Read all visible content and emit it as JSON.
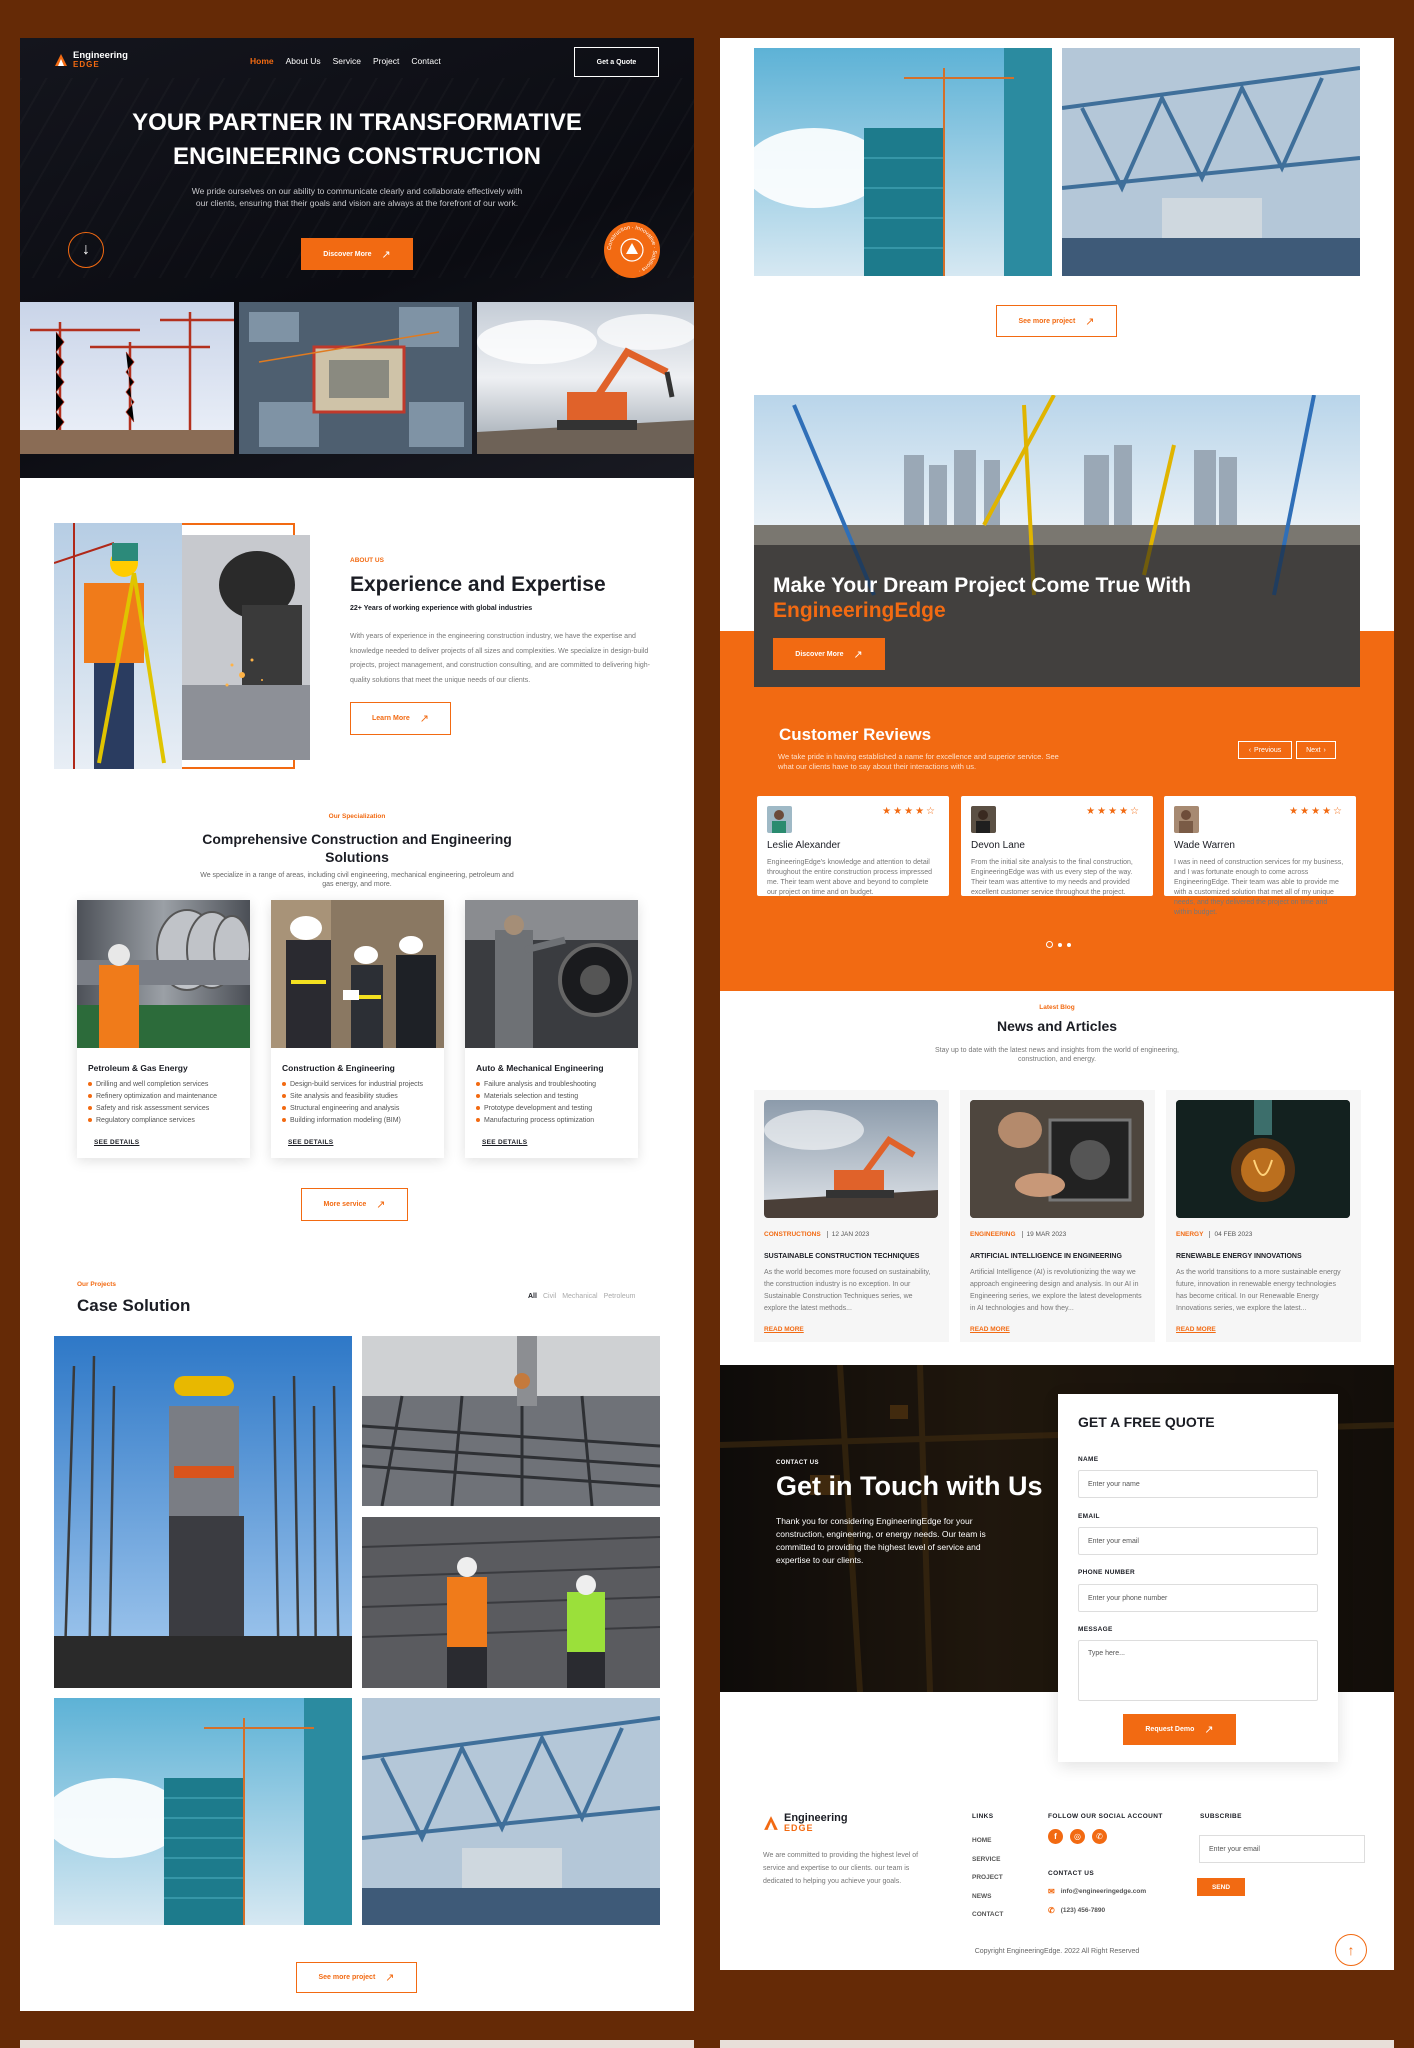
{
  "brand": {
    "name": "Engineering",
    "sub": "EDGE"
  },
  "nav": {
    "items": [
      "Home",
      "About Us",
      "Service",
      "Project",
      "Contact"
    ],
    "quote": "Get a Quote"
  },
  "hero": {
    "title1": "YOUR PARTNER IN TRANSFORMATIVE",
    "title2": "ENGINEERING CONSTRUCTION",
    "text": "We pride ourselves on our ability to communicate clearly and collaborate effectively with our clients, ensuring that their goals and vision are always at the forefront of our work.",
    "cta": "Discover More"
  },
  "about": {
    "tag": "ABOUT US",
    "title": "Experience and Expertise",
    "sub": "22+ Years of working experience with global industries",
    "text": "With years of experience in the engineering construction industry, we have the expertise and knowledge needed to deliver projects of all sizes and complexities. We specialize in design-build projects, project management, and construction consulting, and are committed to delivering high-quality solutions that meet the unique needs of our clients.",
    "cta": "Learn More"
  },
  "spec": {
    "tag": "Our Specialization",
    "title1": "Comprehensive Construction and Engineering",
    "title2": "Solutions",
    "text": "We specialize in a range of areas, including civil engineering, mechanical engineering, petroleum and gas energy, and more.",
    "more": "More service",
    "cards": [
      {
        "title": "Petroleum & Gas Energy",
        "items": [
          "Drilling and well completion services",
          "Refinery optimization and maintenance",
          "Safety and risk assessment services",
          "Regulatory compliance services"
        ],
        "details": "SEE DETAILS"
      },
      {
        "title": "Construction & Engineering",
        "items": [
          "Design-build services for industrial projects",
          "Site analysis and feasibility studies",
          "Structural engineering and analysis",
          "Building information modeling (BIM)"
        ],
        "details": "SEE DETAILS"
      },
      {
        "title": "Auto & Mechanical Engineering",
        "items": [
          "Failure analysis and troubleshooting",
          "Materials selection and testing",
          "Prototype development and testing",
          "Manufacturing process optimization"
        ],
        "details": "SEE DETAILS"
      }
    ]
  },
  "projects": {
    "tag": "Our Projects",
    "title": "Case Solution",
    "filters": [
      "All",
      "Civil",
      "Mechanical",
      "Petroleum"
    ],
    "more": "See more project"
  },
  "dream": {
    "line1": "Make Your Dream Project Come True With",
    "line2": "EngineeringEdge",
    "cta": "Discover More"
  },
  "reviews": {
    "title": "Customer Reviews",
    "text": "We take pride in having established a name for excellence and superior service. See what our clients have to say about their interactions with us.",
    "prev": "Previous",
    "next": "Next",
    "items": [
      {
        "name": "Leslie Alexander",
        "text": "EngineeringEdge's knowledge and attention to detail throughout the entire construction process impressed me. Their team went above and beyond to complete our project on time and on budget."
      },
      {
        "name": "Devon Lane",
        "text": "From the initial site analysis to the final construction, EngineeringEdge was with us every step of the way. Their team was attentive to my needs and provided excellent customer service throughout the project."
      },
      {
        "name": "Wade Warren",
        "text": "I was in need of construction services for my business, and I was fortunate enough to come across EngineeringEdge. Their team was able to provide me with a customized solution that met all of my unique needs, and they delivered the project on time and within budget."
      }
    ]
  },
  "blog": {
    "tag": "Latest Blog",
    "title": "News and Articles",
    "text": "Stay up to date with the latest news and insights from the world of engineering, construction, and energy.",
    "items": [
      {
        "cat": "CONSTRUCTIONS",
        "date": "12 JAN 2023",
        "title": "SUSTAINABLE CONSTRUCTION TECHNIQUES",
        "text": "As the world becomes more focused on sustainability, the construction industry is no exception. In our Sustainable Construction Techniques series, we explore the latest methods...",
        "read": "READ MORE"
      },
      {
        "cat": "ENGINEERING",
        "date": "19 MAR 2023",
        "title": "ARTIFICIAL INTELLIGENCE IN ENGINEERING",
        "text": "Artificial Intelligence (AI) is revolutionizing the way we approach engineering design and analysis. In our AI in Engineering series, we explore the latest developments in AI technologies and how they...",
        "read": "READ MORE"
      },
      {
        "cat": "ENERGY",
        "date": "04 FEB 2023",
        "title": "RENEWABLE ENERGY INNOVATIONS",
        "text": "As the world transitions to a more sustainable energy future, innovation in renewable energy technologies has become critical. In our Renewable Energy Innovations series, we explore the latest...",
        "read": "READ MORE"
      }
    ]
  },
  "contact": {
    "tag": "CONTACT US",
    "title": "Get in Touch with Us",
    "text": "Thank you for considering EngineeringEdge for your construction, engineering, or energy needs. Our team is committed to providing the highest level of service and expertise to our clients.",
    "form": {
      "title": "GET A FREE QUOTE",
      "name_label": "NAME",
      "name_ph": "Enter your name",
      "email_label": "EMAIL",
      "email_ph": "Enter your email",
      "phone_label": "PHONE NUMBER",
      "phone_ph": "Enter your phone number",
      "msg_label": "MESSAGE",
      "msg_ph": "Type here...",
      "submit": "Request Demo"
    }
  },
  "footer": {
    "desc": "We are committed to providing the highest level of service and expertise to our clients. our team is dedicated to helping you achieve your goals.",
    "links_title": "LINKS",
    "links": [
      "HOME",
      "SERVICE",
      "PROJECT",
      "NEWS",
      "CONTACT"
    ],
    "social_title": "FOLLOW OUR SOCIAL ACCOUNT",
    "contact_title": "CONTACT US",
    "email": "info@engineeringedge.com",
    "phone": "(123) 456-7890",
    "sub_title": "SUBSCRIBE",
    "sub_ph": "Enter your email",
    "sub_btn": "SEND",
    "copyright": "Copyright EngineeringEdge. 2022 All Right Reserved"
  },
  "badge": {
    "text": "Construction · Innovative · Solutions ·"
  },
  "colors": {
    "accent": "#f26a12",
    "dark": "#0f1017",
    "bg": "#652a06"
  }
}
